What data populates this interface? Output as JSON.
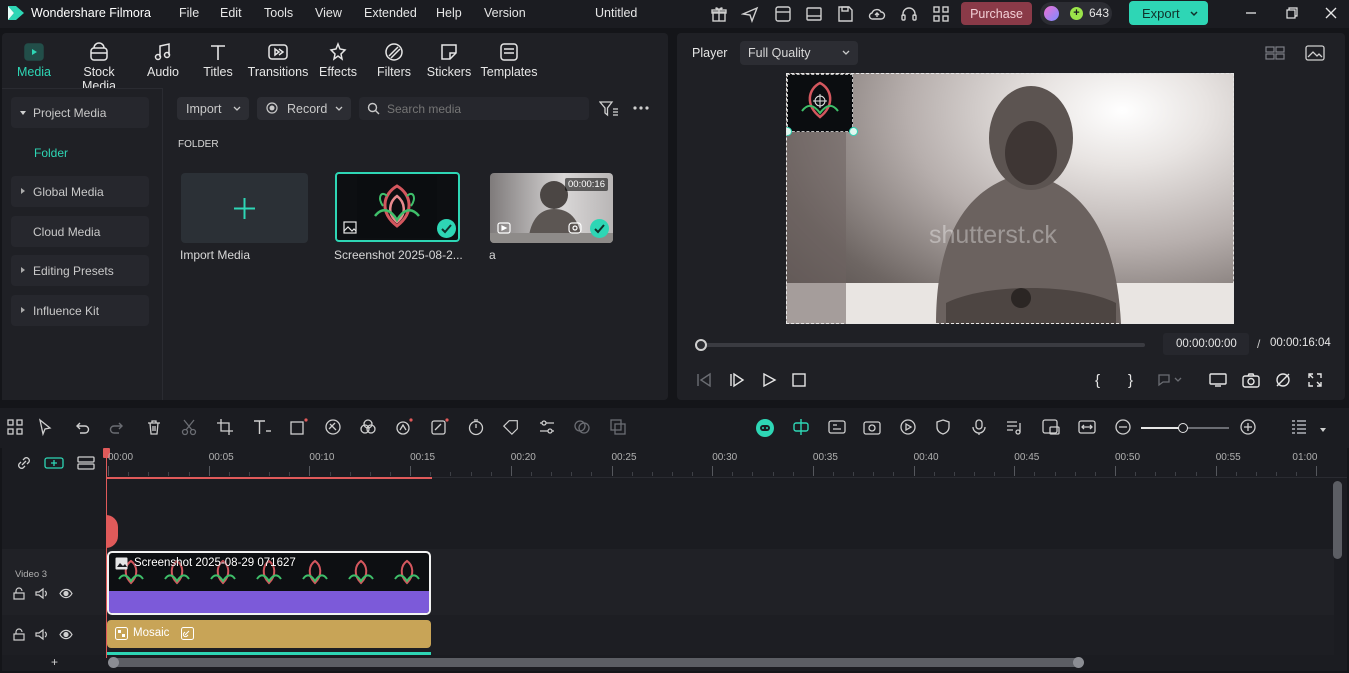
{
  "app": {
    "name": "Wondershare Filmora",
    "project_title": "Untitled",
    "menu": [
      "File",
      "Edit",
      "Tools",
      "View",
      "Extended",
      "Help",
      "Version"
    ],
    "purchase_label": "Purchase",
    "credits": "643",
    "export_label": "Export"
  },
  "tabs": [
    "Media",
    "Stock Media",
    "Audio",
    "Titles",
    "Transitions",
    "Effects",
    "Filters",
    "Stickers",
    "Templates"
  ],
  "sidebar": {
    "project_media": "Project Media",
    "folder": "Folder",
    "global_media": "Global Media",
    "cloud_media": "Cloud Media",
    "editing_presets": "Editing Presets",
    "influence_kit": "Influence Kit"
  },
  "toolbar": {
    "import_label": "Import",
    "record_label": "Record",
    "search_placeholder": "Search media"
  },
  "media": {
    "folder_heading": "FOLDER",
    "import_media_label": "Import Media",
    "items": [
      {
        "name": "Screenshot 2025-08-2...",
        "duration": ""
      },
      {
        "name": "a",
        "duration": "00:00:16"
      }
    ]
  },
  "player": {
    "label": "Player",
    "quality": "Full Quality",
    "watermark": "shutterst.ck",
    "current_time": "00:00:00:00",
    "separator": "/",
    "total_time": "00:00:16:04",
    "progress": 0
  },
  "timeline": {
    "ticks": [
      "00:00",
      "00:05",
      "00:10",
      "00:15",
      "00:20",
      "00:25",
      "00:30",
      "00:35",
      "00:40",
      "00:45",
      "00:50",
      "00:55",
      "01:00"
    ],
    "track_label_video3": "Video 3",
    "clip_screenshot": "Screenshot 2025-08-29 071627",
    "clip_mosaic": "Mosaic",
    "add_track": "+"
  },
  "colors": {
    "accent": "#2ed6b5",
    "purchase": "#8a3a48",
    "export": "#2ed6b5",
    "clip_video": "#7c5ad9",
    "clip_mosaic": "#c8a457",
    "playhead": "#e05a5a"
  }
}
